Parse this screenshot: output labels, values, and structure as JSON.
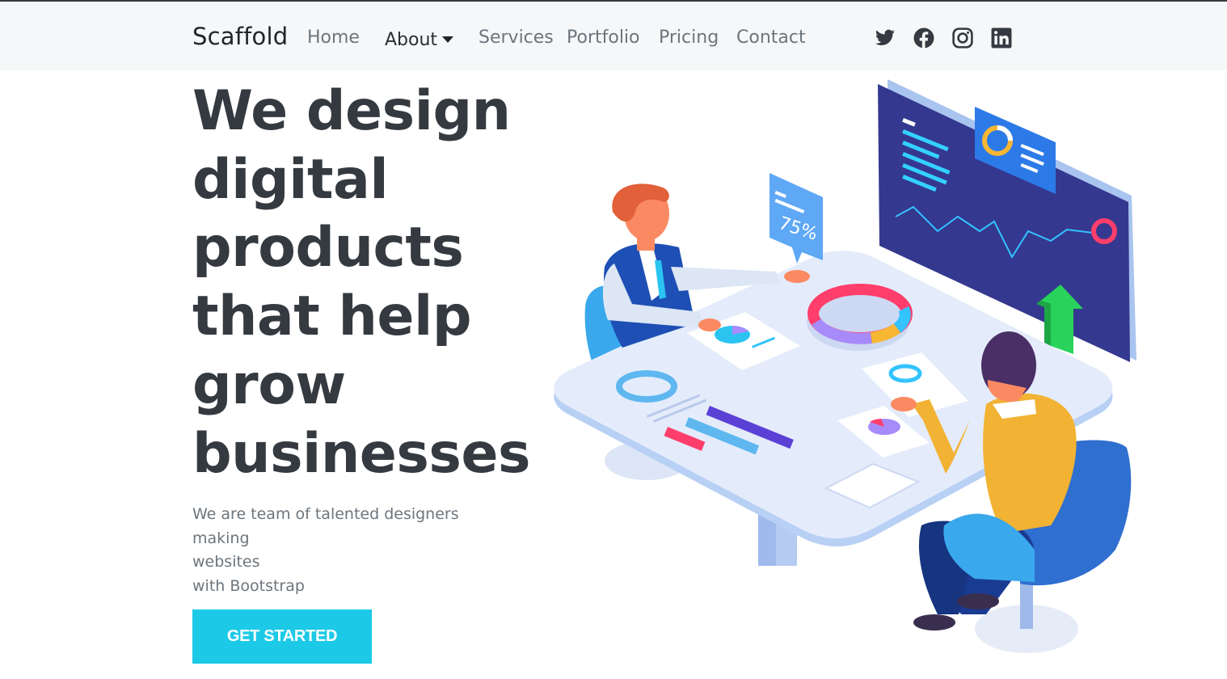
{
  "navbar": {
    "brand": "Scaffold",
    "links": [
      {
        "label": "Home"
      },
      {
        "label": "About"
      },
      {
        "label": "Services"
      },
      {
        "label": "Portfolio"
      },
      {
        "label": "Pricing"
      },
      {
        "label": "Contact"
      }
    ],
    "social": [
      "twitter-icon",
      "facebook-icon",
      "instagram-icon",
      "linkedin-icon"
    ]
  },
  "hero": {
    "title_lines": [
      "We design",
      "digital",
      "products",
      "that help",
      "grow",
      "businesses"
    ],
    "subtitle_lines": [
      "We are team of talented designers making",
      "websites",
      "with Bootstrap"
    ],
    "cta_label": "GET STARTED",
    "illustration": {
      "bubble_text": "75%"
    }
  },
  "colors": {
    "accent": "#1ccae8",
    "heading": "#343a40",
    "navbar_bg": "#f6f7f8",
    "screen": "#35388f"
  }
}
